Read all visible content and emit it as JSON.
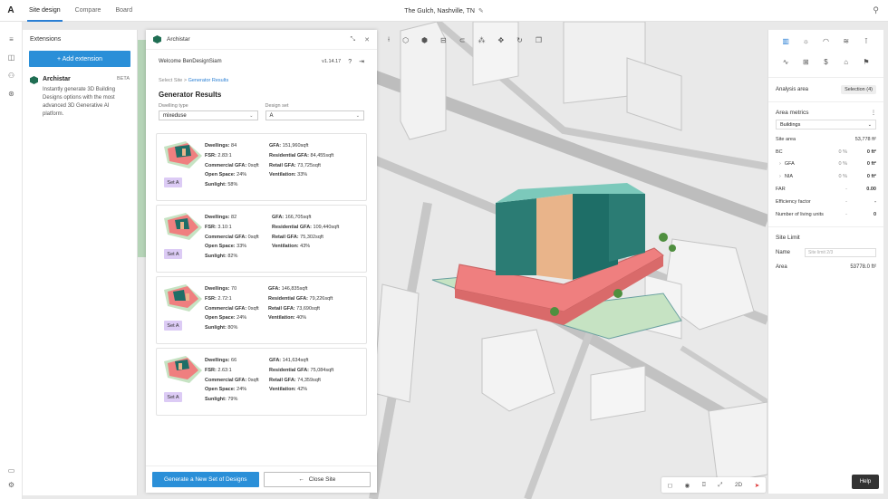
{
  "topbar": {
    "logo": "A",
    "tabs": [
      "Site design",
      "Compare",
      "Board"
    ],
    "project_title": "The Gulch, Nashville, TN",
    "edit_glyph": "✎",
    "user_icon": "person-icon"
  },
  "extensions": {
    "title": "Extensions",
    "add_button": "+ Add extension",
    "item": {
      "name": "Archistar",
      "badge": "BETA",
      "description": "Instantly generate 3D Building Designs options with the most advanced 3D Generative AI platform."
    }
  },
  "archistar": {
    "title": "Archistar",
    "welcome": "Welcome BenDesignSiam",
    "version": "v1.14.17",
    "breadcrumb_root": "Select Site",
    "breadcrumb_sep": " > ",
    "breadcrumb_current": "Generator Results",
    "heading": "Generator Results",
    "dwelling_type_label": "Dwelling type",
    "dwelling_type_value": "mixeduse",
    "design_set_label": "Design set",
    "design_set_value": "A",
    "results": [
      {
        "dwellings": "Dwellings: 84",
        "fsr": "FSR: 2.83:1",
        "commercial": "Commercial GFA: 0sqft",
        "open": "Open Space: 24%",
        "sunlight": "Sunlight: 58%",
        "gfa": "GFA: 151,960sqft",
        "residential": "Residential GFA: 84,455sqft",
        "retail": "Retail GFA: 73,725sqft",
        "ventilation": "Ventilation: 33%",
        "set": "Set A"
      },
      {
        "dwellings": "Dwellings: 82",
        "fsr": "FSR: 3.10:1",
        "commercial": "Commercial GFA: 0sqft",
        "open": "Open Space: 33%",
        "sunlight": "Sunlight: 82%",
        "gfa": "GFA: 166,705sqft",
        "residential": "Residential GFA: 109,440sqft",
        "retail": "Retail GFA: 75,302sqft",
        "ventilation": "Ventilation: 43%",
        "set": "Set A"
      },
      {
        "dwellings": "Dwellings: 70",
        "fsr": "FSR: 2.72:1",
        "commercial": "Commercial GFA: 0sqft",
        "open": "Open Space: 24%",
        "sunlight": "Sunlight: 80%",
        "gfa": "GFA: 146,835sqft",
        "residential": "Residential GFA: 79,226sqft",
        "retail": "Retail GFA: 73,690sqft",
        "ventilation": "Ventilation: 40%",
        "set": "Set A"
      },
      {
        "dwellings": "Dwellings: 66",
        "fsr": "FSR: 2.63:1",
        "commercial": "Commercial GFA: 0sqft",
        "open": "Open Space: 24%",
        "sunlight": "Sunlight: 79%",
        "gfa": "GFA: 141,634sqft",
        "residential": "Residential GFA: 75,084sqft",
        "retail": "Retail GFA: 74,359sqft",
        "ventilation": "Ventilation: 42%",
        "set": "Set A"
      }
    ],
    "generate_button": "Generate a New Set of Designs",
    "close_button": "Close Site",
    "close_arrow": "←"
  },
  "analysis": {
    "area_label": "Analysis area",
    "area_value": "Selection (4)",
    "metrics_title": "Area metrics",
    "metrics_select": "Buildings",
    "site_area_label": "Site area",
    "site_area_value": "53,778 ft²",
    "rows": [
      {
        "label": "BC",
        "pct": "0 %",
        "val": "0 ft²"
      },
      {
        "label": "GFA",
        "pct": "0 %",
        "val": "0 ft²"
      },
      {
        "label": "NIA",
        "pct": "0 %",
        "val": "0 ft²"
      },
      {
        "label": "FAR",
        "pct": "-",
        "val": "0.00"
      },
      {
        "label": "Efficiency factor",
        "pct": "-",
        "val": "-"
      },
      {
        "label": "Number of living units",
        "pct": "-",
        "val": "0"
      }
    ],
    "site_limit_title": "Site Limit",
    "name_label": "Name",
    "name_placeholder": "Site limit 2/3",
    "area_label2": "Area",
    "area_value2": "53778.0 ft²"
  },
  "help": "Help",
  "view_bar": {
    "mode": "2D"
  },
  "colors": {
    "accent": "#2a8fd8",
    "brand": "#1f6e53",
    "podium": "#ef7f7f",
    "tower": "#1e6e67",
    "set_badge": "#dccbf5"
  }
}
